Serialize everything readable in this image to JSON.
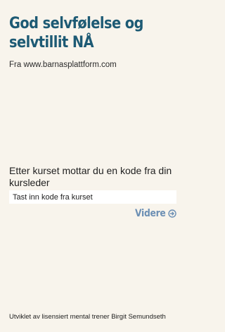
{
  "header": {
    "title": "God selvfølelse og selvtillit NÅ",
    "source_text": "Fra www.barnasplattform.com"
  },
  "main": {
    "instruction_text": "Etter kurset mottar du en kode fra din kursleder",
    "code_input": {
      "value": "",
      "placeholder": "Tast inn kode fra kurset"
    },
    "next_button": {
      "label": "Videre",
      "icon": "arrow-right-circle-icon"
    }
  },
  "footer": {
    "text": "Utviklet av lisensiert mental trener Birgit Semundseth"
  },
  "colors": {
    "background": "#f8f4ec",
    "title": "#1d5a74",
    "accent": "#6c8fb4",
    "input_background": "#ffffff"
  }
}
